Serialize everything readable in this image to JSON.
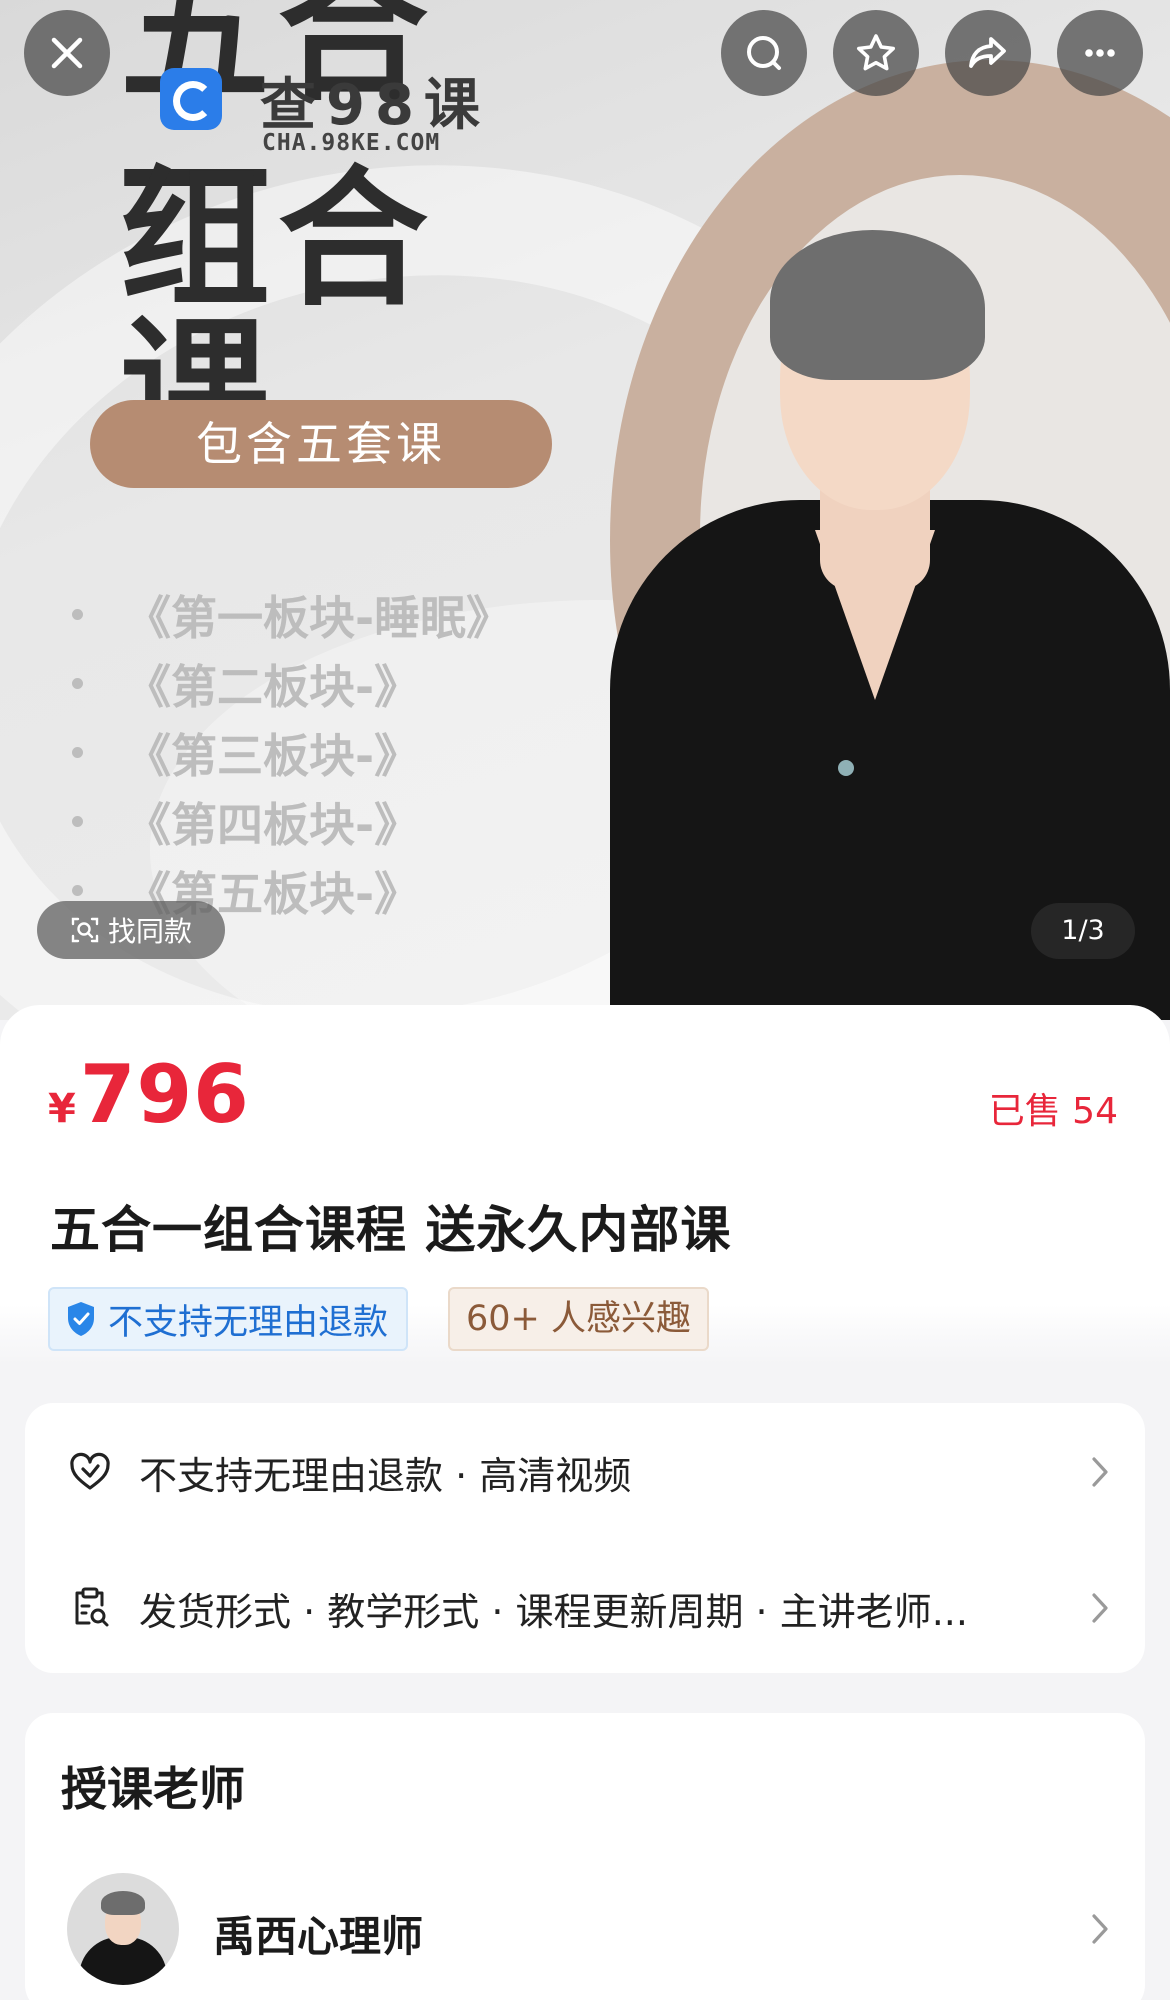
{
  "banner": {
    "title_line1": "五合一",
    "title_line2": "组合课",
    "pill_label": "包含五套课",
    "modules": [
      "《第一板块-睡眠》",
      "《第二板块-》",
      "《第三板块-》",
      "《第四板块-》",
      "《第五板块-》"
    ],
    "watermark_cn": "查98课",
    "watermark_en": "CHA.98KE.COM",
    "find_same_label": "找同款",
    "page_indicator": "1/3"
  },
  "toolbar": {
    "icons": [
      "close-icon",
      "search-icon",
      "star-icon",
      "share-icon",
      "more-icon"
    ]
  },
  "product": {
    "currency": "¥",
    "price": "796",
    "sold": "已售 54",
    "title": "五合一组合课程 送永久内部课",
    "tag_refund": "不支持无理由退款",
    "tag_interest": "60+ 人感兴趣"
  },
  "info_rows": [
    {
      "icon": "heart-shield-icon",
      "text": "不支持无理由退款 · 高清视频"
    },
    {
      "icon": "clipboard-search-icon",
      "text": "发货形式 · 教学形式 · 课程更新周期 · 主讲老师..."
    }
  ],
  "teacher": {
    "heading": "授课老师",
    "name": "禹西心理师"
  },
  "colors": {
    "price_red": "#e8263a",
    "refund_blue": "#1f6fd2",
    "pill_brown": "#b68c72"
  }
}
